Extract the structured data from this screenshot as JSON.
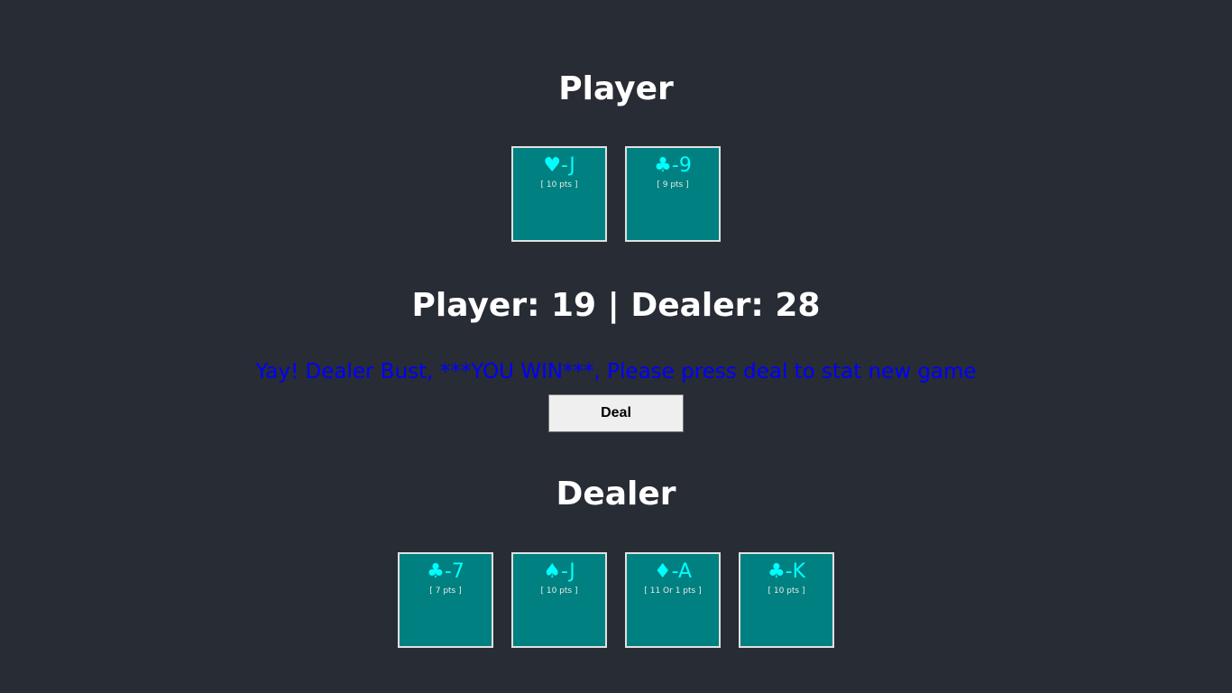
{
  "player": {
    "heading": "Player",
    "cards": [
      {
        "face": "♥-J",
        "points": "[ 10 pts ]"
      },
      {
        "face": "♣-9",
        "points": "[ 9 pts ]"
      }
    ]
  },
  "score": {
    "text": "Player: 19 | Dealer: 28"
  },
  "message": "Yay! Dealer Bust, ***YOU WIN***, Please press deal to stat new game",
  "deal_button": {
    "label": "Deal"
  },
  "dealer": {
    "heading": "Dealer",
    "cards": [
      {
        "face": "♣-7",
        "points": "[ 7 pts ]"
      },
      {
        "face": "♠-J",
        "points": "[ 10 pts ]"
      },
      {
        "face": "♦-A",
        "points": "[ 11 Or 1 pts ]"
      },
      {
        "face": "♣-K",
        "points": "[ 10 pts ]"
      }
    ]
  },
  "colors": {
    "background": "#282c34",
    "card_background": "#008080",
    "card_text": "#00ffff",
    "message_text": "#0000ff",
    "heading_text": "#ffffff"
  }
}
